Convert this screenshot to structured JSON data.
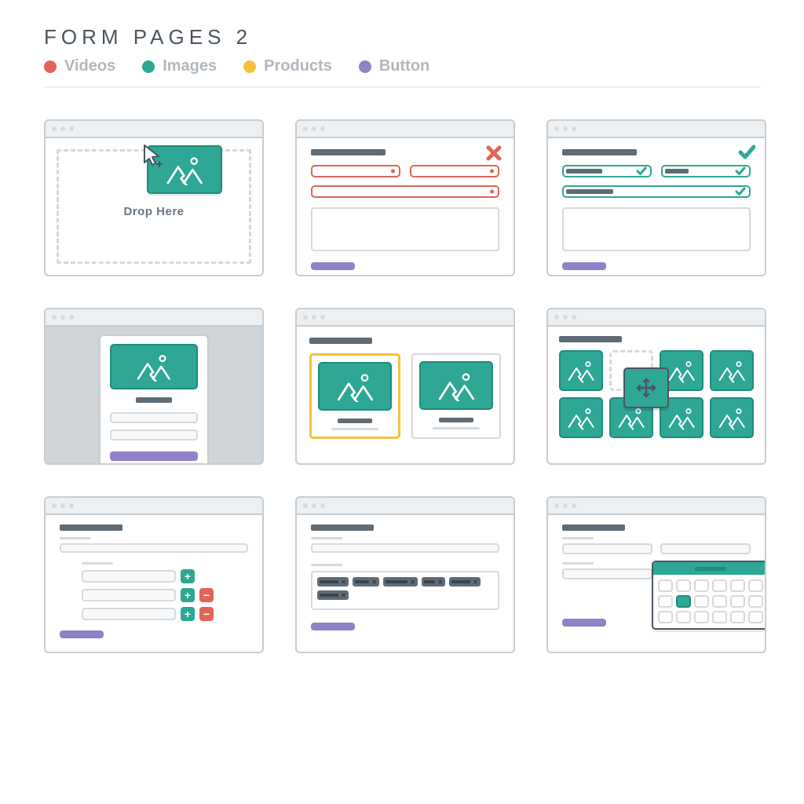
{
  "header": {
    "title": "FORM  PAGES  2",
    "legend": [
      {
        "label": "Videos",
        "color": "#e16557"
      },
      {
        "label": "Images",
        "color": "#2ea795"
      },
      {
        "label": "Products",
        "color": "#f2c23e"
      },
      {
        "label": "Button",
        "color": "#9081c8"
      }
    ]
  },
  "wireframes": {
    "drop": {
      "label": "Drop Here"
    },
    "form_error": {
      "status": "error"
    },
    "form_success": {
      "status": "success"
    },
    "login_card": {},
    "product_select": {
      "selected_index": 0,
      "count": 2
    },
    "image_grid_reorder": {
      "tiles": 7
    },
    "repeat_fields": {
      "rows": 3
    },
    "tags_input": {
      "tags": 6
    },
    "date_picker": {
      "rows": 3,
      "cols": 6
    }
  }
}
